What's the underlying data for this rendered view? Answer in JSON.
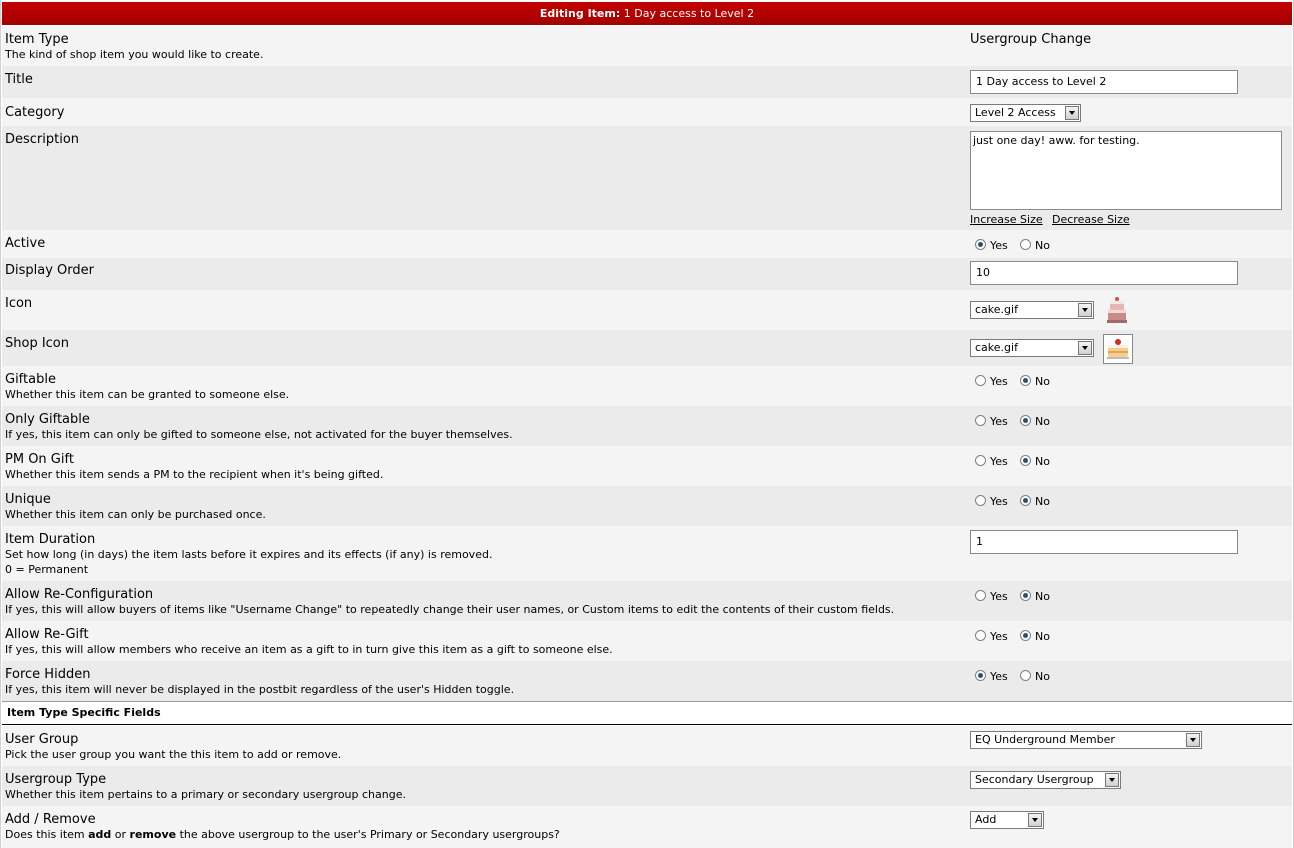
{
  "header": {
    "prefix": "Editing Item:",
    "item_name": "1 Day access to Level 2"
  },
  "item_type": {
    "label": "Item Type",
    "desc": "The kind of shop item you would like to create.",
    "value": "Usergroup Change"
  },
  "title": {
    "label": "Title",
    "value": "1 Day access to Level 2"
  },
  "category": {
    "label": "Category",
    "value": "Level 2 Access"
  },
  "description": {
    "label": "Description",
    "value": "just one day! aww. for testing.",
    "increase": "Increase Size",
    "decrease": "Decrease Size"
  },
  "active": {
    "label": "Active",
    "yes": "Yes",
    "no": "No",
    "selected": "Yes"
  },
  "display_order": {
    "label": "Display Order",
    "value": "10"
  },
  "icon": {
    "label": "Icon",
    "value": "cake.gif",
    "icon_name": "cake-icon"
  },
  "shop_icon": {
    "label": "Shop Icon",
    "value": "cake.gif",
    "icon_name": "cake-slice-icon"
  },
  "giftable": {
    "label": "Giftable",
    "desc": "Whether this item can be granted to someone else.",
    "yes": "Yes",
    "no": "No",
    "selected": "No"
  },
  "only_giftable": {
    "label": "Only Giftable",
    "desc": "If yes, this item can only be gifted to someone else, not activated for the buyer themselves.",
    "yes": "Yes",
    "no": "No",
    "selected": "No"
  },
  "pm_on_gift": {
    "label": "PM On Gift",
    "desc": "Whether this item sends a PM to the recipient when it's being gifted.",
    "yes": "Yes",
    "no": "No",
    "selected": "No"
  },
  "unique": {
    "label": "Unique",
    "desc": "Whether this item can only be purchased once.",
    "yes": "Yes",
    "no": "No",
    "selected": "No"
  },
  "item_duration": {
    "label": "Item Duration",
    "desc": "Set how long (in days) the item lasts before it expires and its effects (if any) is removed.",
    "desc2": "0 = Permanent",
    "value": "1"
  },
  "allow_reconfig": {
    "label": "Allow Re-Configuration",
    "desc": "If yes, this will allow buyers of items like \"Username Change\" to repeatedly change their user names, or Custom items to edit the contents of their custom fields.",
    "yes": "Yes",
    "no": "No",
    "selected": "No"
  },
  "allow_regift": {
    "label": "Allow Re-Gift",
    "desc": "If yes, this will allow members who receive an item as a gift to in turn give this item as a gift to someone else.",
    "yes": "Yes",
    "no": "No",
    "selected": "No"
  },
  "force_hidden": {
    "label": "Force Hidden",
    "desc": "If yes, this item will never be displayed in the postbit regardless of the user's Hidden toggle.",
    "yes": "Yes",
    "no": "No",
    "selected": "Yes"
  },
  "section": {
    "title": "Item Type Specific Fields"
  },
  "user_group": {
    "label": "User Group",
    "desc": "Pick the user group you want the this item to add or remove.",
    "value": "EQ Underground Member"
  },
  "usergroup_type": {
    "label": "Usergroup Type",
    "desc": "Whether this item pertains to a primary or secondary usergroup change.",
    "value": "Secondary Usergroup"
  },
  "add_remove": {
    "label": "Add / Remove",
    "desc_a": "Does this item ",
    "desc_b": "add",
    "desc_c": " or ",
    "desc_d": "remove",
    "desc_e": " the above usergroup to the user's Primary or Secondary usergroups?",
    "value": "Add"
  }
}
